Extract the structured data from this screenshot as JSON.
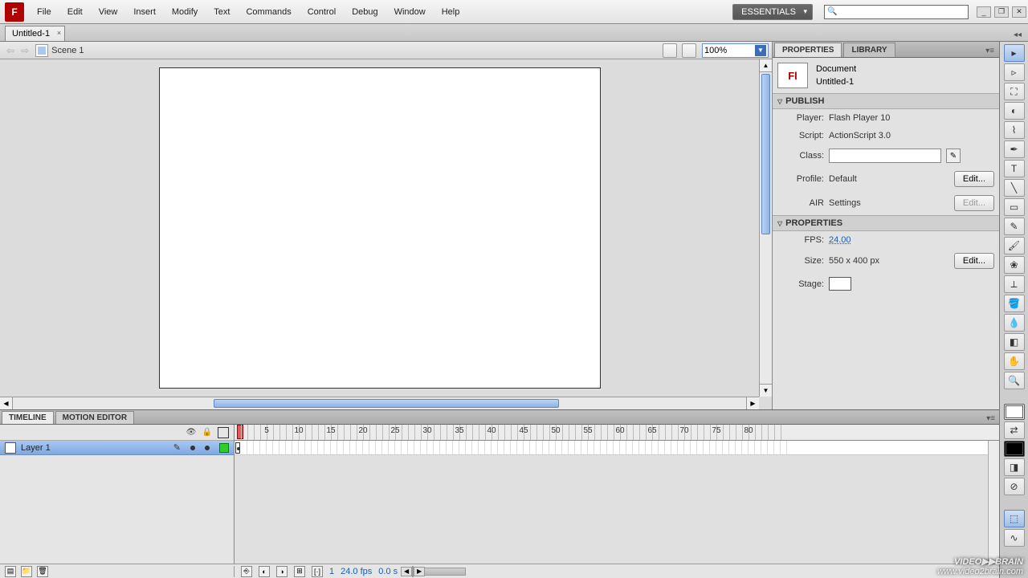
{
  "app": {
    "icon_letter": "F"
  },
  "menu": [
    "File",
    "Edit",
    "View",
    "Insert",
    "Modify",
    "Text",
    "Commands",
    "Control",
    "Debug",
    "Window",
    "Help"
  ],
  "workspace_label": "ESSENTIALS",
  "search_placeholder": "",
  "window_controls": {
    "min": "_",
    "max": "❐",
    "close": "✕"
  },
  "doc_tab": {
    "title": "Untitled-1",
    "close": "×"
  },
  "edit_bar": {
    "scene": "Scene 1",
    "zoom": "100%"
  },
  "panels": {
    "tabs": {
      "properties": "PROPERTIES",
      "library": "LIBRARY"
    },
    "doc": {
      "kind": "Document",
      "name": "Untitled-1",
      "icon": "Fl"
    },
    "publish_head": "PUBLISH",
    "publish": {
      "player_lbl": "Player:",
      "player_val": "Flash Player 10",
      "script_lbl": "Script:",
      "script_val": "ActionScript 3.0",
      "class_lbl": "Class:",
      "class_val": "",
      "profile_lbl": "Profile:",
      "profile_val": "Default",
      "air_lbl": "AIR",
      "air_val": "Settings",
      "edit_btn": "Edit..."
    },
    "props_head": "PROPERTIES",
    "props": {
      "fps_lbl": "FPS:",
      "fps_val": "24.00",
      "size_lbl": "Size:",
      "size_val": "550 x 400 px",
      "stage_lbl": "Stage:",
      "edit_btn": "Edit..."
    }
  },
  "timeline": {
    "tabs": {
      "timeline": "TIMELINE",
      "motion": "MOTION EDITOR"
    },
    "layer_name": "Layer 1",
    "ruler_numbers": [
      5,
      10,
      15,
      20,
      25,
      30,
      35,
      40,
      45,
      50,
      55,
      60,
      65,
      70,
      75,
      80
    ],
    "footer": {
      "frame": "1",
      "fps": "24.0 fps",
      "time": "0.0 s"
    }
  },
  "tools": [
    "sel",
    "subsel",
    "free",
    "3d",
    "lasso",
    "pen",
    "text",
    "line",
    "rect",
    "pencil",
    "brush",
    "deco",
    "bone",
    "paint",
    "ink",
    "eraser",
    "hand",
    "zoom"
  ],
  "watermark": {
    "main": "VIDEO▶▶BRAIN",
    "sub": "www.video2brain.com",
    "two": "2"
  }
}
